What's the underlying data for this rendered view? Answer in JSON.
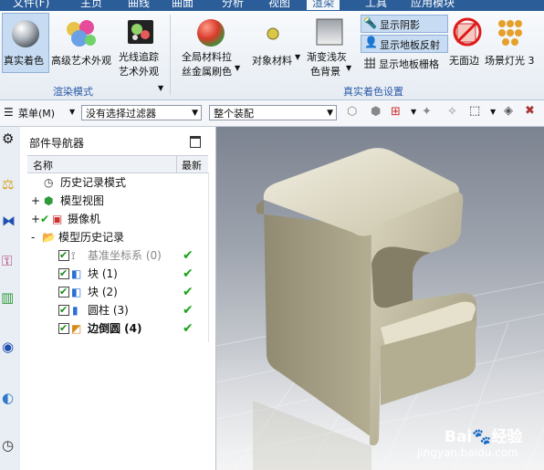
{
  "menu_tabs": [
    "文件(F)",
    "主页",
    "曲线",
    "曲面",
    "分析",
    "视图",
    "渲染",
    "工具",
    "应用模块"
  ],
  "active_tab": "渲染",
  "ribbon": {
    "render_mode": {
      "items": [
        {
          "label": "真实着色",
          "icon": "sphere-icon",
          "active": true
        },
        {
          "label": "高级艺术外观",
          "icon": "art-spheres-icon"
        },
        {
          "label_line1": "光线追踪",
          "label_line2": "艺术外观",
          "icon": "ray-trace-icon"
        }
      ],
      "group_title": "渲染模式"
    },
    "truth_shading": {
      "items": [
        {
          "label_line1": "全局材料拉",
          "label_line2": "丝金属刷色",
          "icon": "material-sphere-icon"
        },
        {
          "label": "对象材料",
          "icon": "object-material-icon"
        },
        {
          "label_line1": "渐变浅灰",
          "label_line2": "色背景",
          "icon": "gradient-background-icon"
        },
        {
          "label": "显示阴影",
          "icon": "shadow-icon",
          "active": true
        },
        {
          "label": "显示地板反射",
          "icon": "floor-reflection-icon",
          "active": true
        },
        {
          "label": "显示地板栅格",
          "icon": "floor-grid-icon"
        },
        {
          "label": "无面边",
          "icon": "no-face-edge-icon"
        },
        {
          "label": "场景灯光 3",
          "icon": "scene-lights-icon"
        }
      ],
      "group_title": "真实着色设置"
    }
  },
  "toolbar": {
    "menu_label": "菜单(M)",
    "filter_value": "没有选择过滤器",
    "assembly_value": "整个装配"
  },
  "navigator": {
    "title": "部件导航器",
    "col_name": "名称",
    "col_latest": "最新",
    "items": [
      {
        "label": "历史记录模式",
        "icon": "history-clock-icon",
        "indent": 0
      },
      {
        "label": "模型视图",
        "icon": "model-view-icon",
        "indent": 0,
        "expander": "+"
      },
      {
        "label": "摄像机",
        "icon": "camera-icon",
        "indent": 0,
        "expander": "+",
        "check_mark": true
      },
      {
        "label": "模型历史记录",
        "icon": "folder-icon",
        "indent": 0,
        "expander": "-"
      },
      {
        "label": "基准坐标系 (0)",
        "icon": "datum-csys-icon",
        "indent": 1,
        "checkbox": true,
        "latest": true,
        "dim": true
      },
      {
        "label": "块 (1)",
        "icon": "block-icon",
        "indent": 1,
        "checkbox": true,
        "latest": true
      },
      {
        "label": "块 (2)",
        "icon": "block-icon",
        "indent": 1,
        "checkbox": true,
        "latest": true
      },
      {
        "label": "圆柱 (3)",
        "icon": "cylinder-icon",
        "indent": 1,
        "checkbox": true,
        "latest": true
      },
      {
        "label": "边倒圆 (4)",
        "icon": "edge-blend-icon",
        "indent": 1,
        "checkbox": true,
        "latest": true,
        "bold": true
      }
    ]
  },
  "watermark": {
    "brand": "Bai",
    "brand2": "经验",
    "url": "jingyan.baidu.com"
  }
}
